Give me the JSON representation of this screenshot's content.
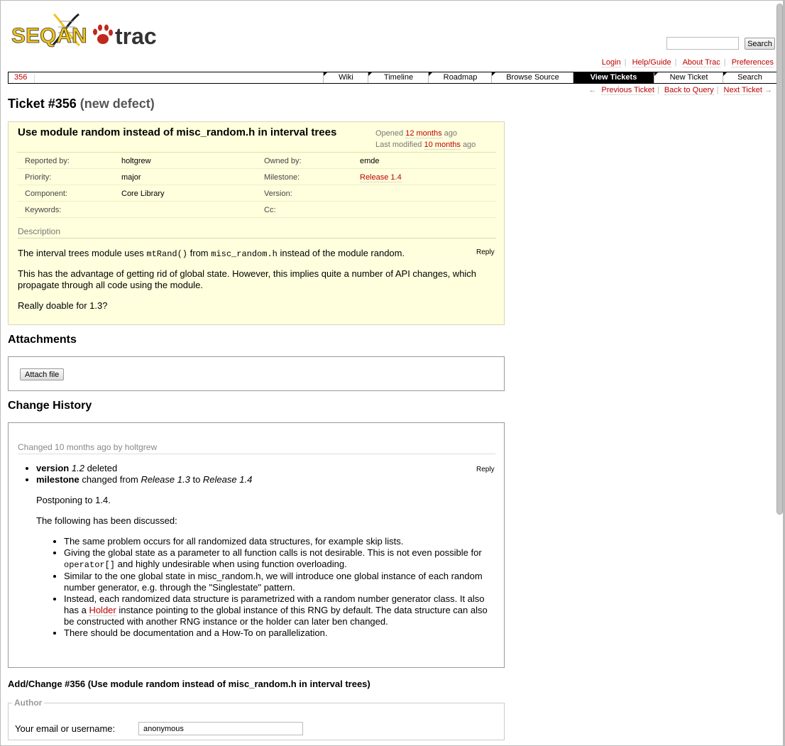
{
  "logo": {
    "text_seqan": "SEQAN",
    "text_trac": "trac"
  },
  "search": {
    "button_label": "Search",
    "placeholder": ""
  },
  "metanav": [
    "Login",
    "Help/Guide",
    "About Trac",
    "Preferences"
  ],
  "mainnav": {
    "context_label": "356",
    "items": [
      "Wiki",
      "Timeline",
      "Roadmap",
      "Browse Source",
      "View Tickets",
      "New Ticket",
      "Search"
    ],
    "active": "View Tickets"
  },
  "ctxnav": {
    "prev_arrow": "←",
    "prev": "Previous Ticket",
    "back": "Back to Query",
    "next": "Next Ticket",
    "next_arrow": "→"
  },
  "ticket": {
    "title": "Ticket #356",
    "status": "(new defect)",
    "summary": "Use module random instead of misc_random.h in interval trees",
    "opened_prefix": "Opened",
    "opened_link": "12 months",
    "opened_suffix": "ago",
    "modified_prefix": "Last modified",
    "modified_link": "10 months",
    "modified_suffix": "ago",
    "props": {
      "reported_by_label": "Reported by:",
      "reported_by": "holtgrew",
      "owned_by_label": "Owned by:",
      "owned_by": "emde",
      "priority_label": "Priority:",
      "priority": "major",
      "milestone_label": "Milestone:",
      "milestone": "Release 1.4",
      "component_label": "Component:",
      "component": "Core Library",
      "version_label": "Version:",
      "version": "",
      "keywords_label": "Keywords:",
      "keywords": "",
      "cc_label": "Cc:",
      "cc": ""
    },
    "description_heading": "Description",
    "desc1_a": "The interval trees module uses",
    "desc1_code1": "mtRand()",
    "desc1_b": "from",
    "desc1_code2": "misc_random.h",
    "desc1_c": "instead of the module random.",
    "desc2": "This has the advantage of getting rid of global state. However, this implies quite a number of API changes, which propagate through all code using the module.",
    "desc3": "Really doable for 1.3?",
    "reply": "Reply"
  },
  "attachments": {
    "heading": "Attachments",
    "button": "Attach file"
  },
  "history": {
    "heading": "Change History",
    "changed_header": "Changed 10 months ago by holtgrew",
    "reply": "Reply",
    "change1_field": "version",
    "change1_old": "1.2",
    "change1_text": "deleted",
    "change2_field": "milestone",
    "change2_text": "changed from",
    "change2_old": "Release 1.3",
    "change2_to": "to",
    "change2_new": "Release 1.4",
    "p1": "Postponing to 1.4.",
    "p2": "The following has been discussed:",
    "b1": "The same problem occurs for all randomized data structures, for example skip lists.",
    "b2_a": "Giving the global state as a parameter to all function calls is not desirable. This is not even possible for",
    "b2_code": "operator[]",
    "b2_b": "and highly undesirable when using function overloading.",
    "b3": "Similar to the one global state in misc_random.h, we will introduce one global instance of each random number generator, e.g. through the \"Singlestate\" pattern.",
    "b4_a": "Instead, each randomized data structure is parametrized with a random number generator class. It also has a",
    "b4_link": "Holder",
    "b4_b": "instance pointing to the global instance of this RNG by default. The data structure can also be constructed with another RNG instance or the holder can later ben changed.",
    "b5": "There should be documentation and a How-To on parallelization."
  },
  "add_change": {
    "heading": "Add/Change #356 (Use module random instead of misc_random.h in interval trees)",
    "author_legend": "Author",
    "author_label": "Your email or username:",
    "author_value": "anonymous"
  }
}
